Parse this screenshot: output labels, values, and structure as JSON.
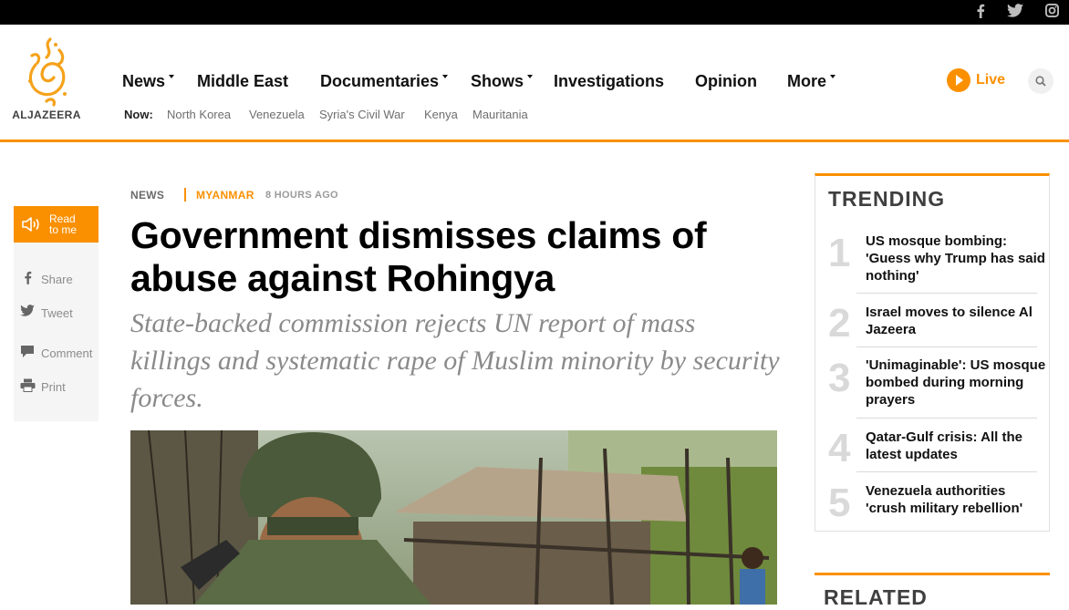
{
  "social": {
    "facebook_glyph": "f",
    "twitter_glyph": "t",
    "instagram_glyph": "i"
  },
  "brand": {
    "logo_text": "ALJAZEERA",
    "accent": "#fa9000"
  },
  "nav": {
    "items": [
      {
        "label": "News"
      },
      {
        "label": "Middle East"
      },
      {
        "label": "Documentaries"
      },
      {
        "label": "Shows"
      },
      {
        "label": "Investigations"
      },
      {
        "label": "Opinion"
      },
      {
        "label": "More"
      }
    ],
    "now_label": "Now:",
    "now_links": [
      "North Korea",
      "Venezuela",
      "Syria's Civil War",
      "Kenya",
      "Mauritania"
    ],
    "live_label": "Live"
  },
  "rail": {
    "read_to_me": "Read to me",
    "share": "Share",
    "tweet": "Tweet",
    "comment": "Comment",
    "print": "Print"
  },
  "article": {
    "section": "NEWS",
    "topic": "MYANMAR",
    "time": "8 HOURS AGO",
    "headline": "Government dismisses claims of abuse against Rohingya",
    "standfirst": "State-backed commission rejects UN report of mass killings and systematic rape of Muslim minority by security forces."
  },
  "trending": {
    "title": "TRENDING",
    "items": [
      {
        "num": "1",
        "text": "US mosque bombing: 'Guess why Trump has said nothing'"
      },
      {
        "num": "2",
        "text": "Israel moves to silence Al Jazeera"
      },
      {
        "num": "3",
        "text": "'Unimaginable': US mosque bombed during morning prayers"
      },
      {
        "num": "4",
        "text": "Qatar-Gulf crisis: All the latest updates"
      },
      {
        "num": "5",
        "text": "Venezuela authorities 'crush military rebellion'"
      }
    ]
  },
  "related": {
    "title": "RELATED"
  }
}
